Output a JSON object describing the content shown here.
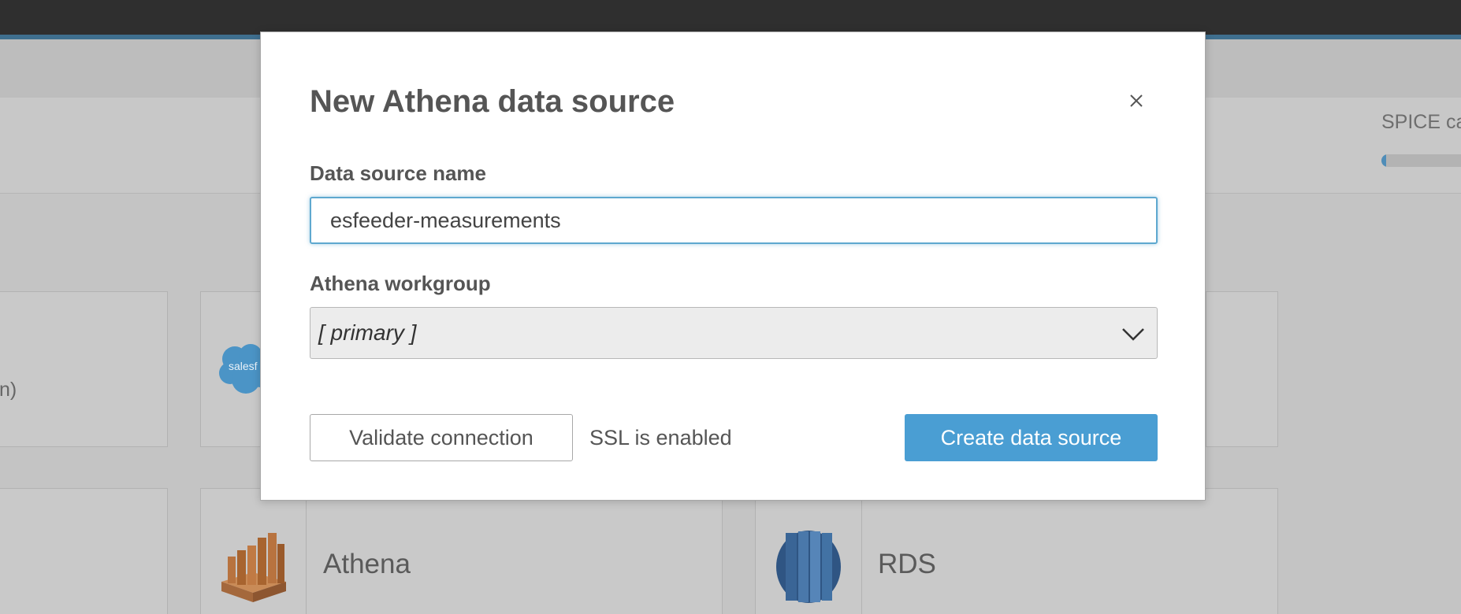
{
  "background": {
    "spice_label": "SPICE ca",
    "spice_usage_fraction": 0.05,
    "cards": {
      "partial_text": "n)",
      "salesforce_text": "salesf",
      "athena_title": "Athena",
      "rds_title": "RDS"
    }
  },
  "dialog": {
    "title": "New Athena data source",
    "name_label": "Data source name",
    "name_value": "esfeeder-measurements",
    "workgroup_label": "Athena workgroup",
    "workgroup_value": "[ primary ]",
    "validate_label": "Validate connection",
    "ssl_status": "SSL is enabled",
    "create_label": "Create data source"
  },
  "colors": {
    "primary": "#4a9ed3",
    "focus": "#5ea8cf",
    "topbar": "#2f2f2f"
  },
  "icons": [
    "close-icon",
    "chevron-down-icon",
    "salesforce-icon",
    "athena-icon",
    "rds-icon"
  ]
}
